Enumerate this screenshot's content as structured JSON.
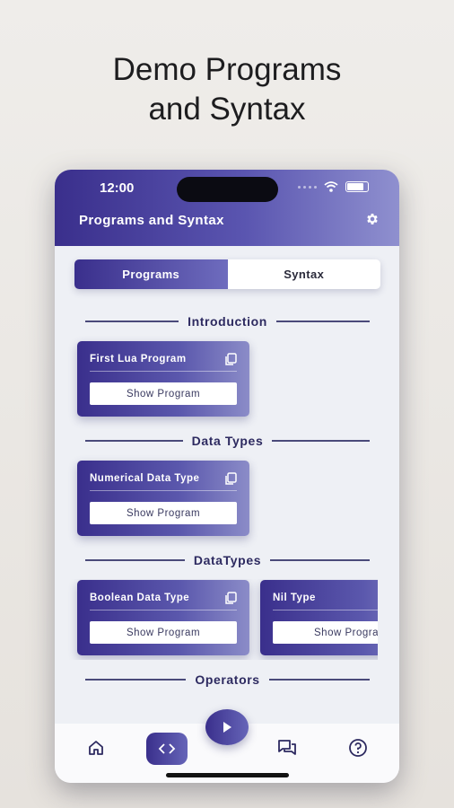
{
  "hero": {
    "title": "Demo Programs\nand Syntax"
  },
  "status": {
    "time": "12:00"
  },
  "appbar": {
    "title": "Programs and Syntax",
    "settings_icon": "gear-icon"
  },
  "segments": {
    "programs": "Programs",
    "syntax": "Syntax",
    "selected": "Programs"
  },
  "sections": {
    "introduction": {
      "label": "Introduction",
      "cards": [
        {
          "title": "First Lua Program",
          "button": "Show Program"
        }
      ]
    },
    "data_types": {
      "label": "Data Types",
      "cards": [
        {
          "title": "Numerical Data Type",
          "button": "Show Program"
        }
      ]
    },
    "datatypes": {
      "label": "DataTypes",
      "cards": [
        {
          "title": "Boolean Data Type",
          "button": "Show Program"
        },
        {
          "title": "Nil Type",
          "button": "Show Progra"
        }
      ]
    },
    "operators": {
      "label": "Operators"
    }
  },
  "nav": {
    "items": [
      "home-icon",
      "code-icon",
      "play-icon",
      "chat-icon",
      "help-icon"
    ]
  },
  "colors": {
    "brand_dark": "#3a2f8c",
    "brand_light": "#8f90cf",
    "background": "#eef0f5"
  }
}
